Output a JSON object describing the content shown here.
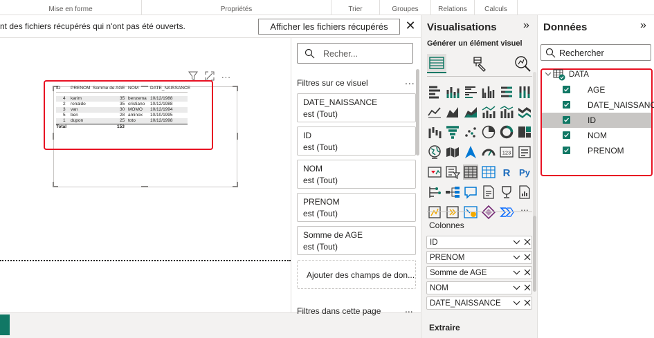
{
  "ribbon": {
    "groups": [
      "Mise en forme",
      "Propriétés",
      "Trier",
      "Groupes",
      "Relations",
      "Calculs"
    ]
  },
  "notification": {
    "text": "nt des fichiers récupérés qui n'ont pas été ouverts.",
    "button": "Afficher les fichiers récupérés",
    "close": "✕"
  },
  "visual_table": {
    "headers": [
      "ID",
      "PRENOM",
      "Somme de AGE",
      "NOM",
      "DATE_NAISSANCE"
    ],
    "rows": [
      {
        "id": "4",
        "prenom": "karim",
        "age": "35",
        "nom": "benzema",
        "date": "10/12/1988"
      },
      {
        "id": "2",
        "prenom": "ronaldo",
        "age": "35",
        "nom": "cristiano",
        "date": "10/12/1988"
      },
      {
        "id": "3",
        "prenom": "van",
        "age": "30",
        "nom": "MOMO",
        "date": "10/12/1994"
      },
      {
        "id": "5",
        "prenom": "ben",
        "age": "28",
        "nom": "aminox",
        "date": "10/10/1995"
      },
      {
        "id": "1",
        "prenom": "dupon",
        "age": "25",
        "nom": "toto",
        "date": "10/12/1998"
      }
    ],
    "total_label": "Total",
    "total_value": "153"
  },
  "filters": {
    "search_placeholder": "Recher...",
    "section_title": "Filtres sur ce visuel",
    "more": "...",
    "cards": [
      {
        "name": "DATE_NAISSANCE",
        "value": "est (Tout)"
      },
      {
        "name": "ID",
        "value": "est (Tout)"
      },
      {
        "name": "NOM",
        "value": "est (Tout)"
      },
      {
        "name": "PRENOM",
        "value": "est (Tout)"
      },
      {
        "name": "Somme de AGE",
        "value": "est (Tout)"
      }
    ],
    "add_fields": "Ajouter des champs de don...",
    "page_section": "Filtres dans cette page"
  },
  "visualizations": {
    "title": "Visualisations",
    "collapse": "»",
    "subtitle": "Générer un élément visuel",
    "columns_title": "Colonnes",
    "wells": [
      "ID",
      "PRENOM",
      "Somme de AGE",
      "NOM",
      "DATE_NAISSANCE"
    ],
    "extract_title": "Extraire",
    "more_icon": "...",
    "r_label": "R",
    "py_label": "Py",
    "num_label": "123"
  },
  "data_pane": {
    "title": "Données",
    "collapse": "»",
    "search_placeholder": "Rechercher",
    "table_name": "DATA",
    "fields": [
      {
        "name": "AGE",
        "checked": true,
        "selected": false
      },
      {
        "name": "DATE_NAISSANCE",
        "checked": true,
        "selected": false
      },
      {
        "name": "ID",
        "checked": true,
        "selected": true
      },
      {
        "name": "NOM",
        "checked": true,
        "selected": false
      },
      {
        "name": "PRENOM",
        "checked": true,
        "selected": false
      }
    ]
  },
  "colors": {
    "accent_green": "#117865",
    "highlight_red": "#e81123",
    "pane_bg": "#f3f2f1"
  }
}
